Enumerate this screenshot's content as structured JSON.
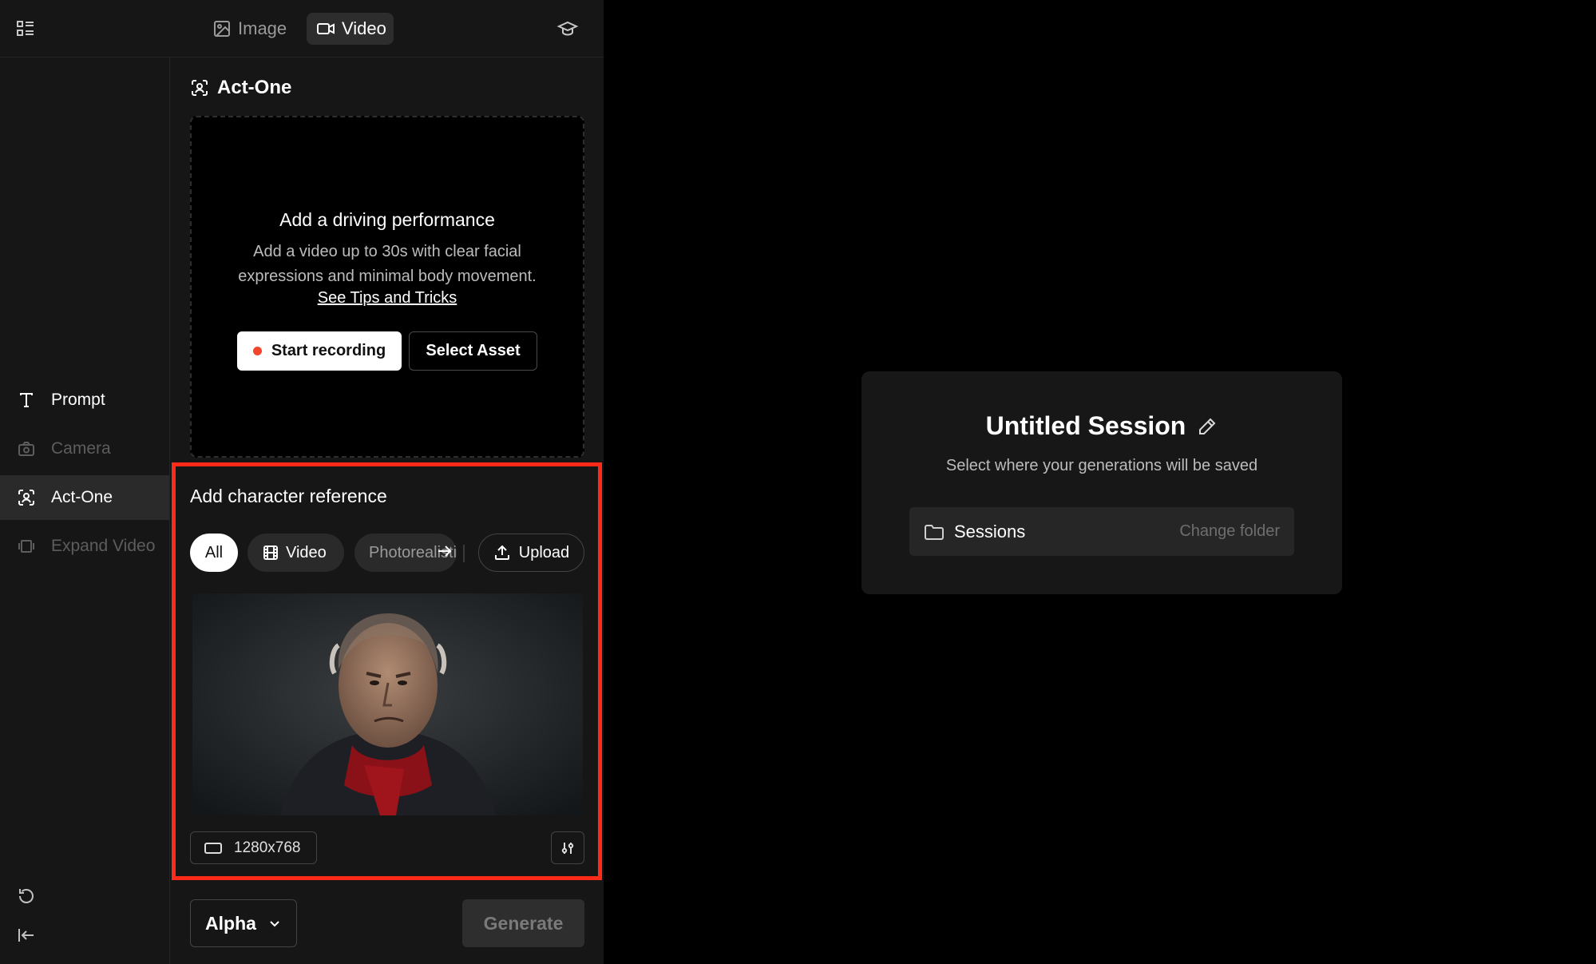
{
  "header": {
    "tabs": [
      {
        "label": "Image",
        "icon": "image-icon"
      },
      {
        "label": "Video",
        "icon": "video-camera-icon",
        "active": true
      }
    ]
  },
  "sidebar": {
    "items": [
      {
        "label": "Prompt",
        "icon": "text-icon",
        "state": "enabled"
      },
      {
        "label": "Camera",
        "icon": "camera-icon",
        "state": "disabled"
      },
      {
        "label": "Act-One",
        "icon": "face-scan-icon",
        "state": "active"
      },
      {
        "label": "Expand Video",
        "icon": "expand-icon",
        "state": "disabled"
      }
    ]
  },
  "panel": {
    "title": "Act-One",
    "dropzone": {
      "title": "Add a driving performance",
      "description": "Add a video up to 30s with clear facial expressions and minimal body movement.",
      "link": "See Tips and Tricks",
      "record_label": "Start recording",
      "asset_label": "Select Asset"
    },
    "character": {
      "title": "Add character reference",
      "filters": {
        "all": "All",
        "video": "Video",
        "photo": "Photorealistic"
      },
      "upload_label": "Upload",
      "resolution": "1280x768"
    },
    "model": "Alpha",
    "generate_label": "Generate"
  },
  "session": {
    "title": "Untitled Session",
    "subtitle": "Select where your generations will be saved",
    "folder": "Sessions",
    "change_label": "Change folder"
  },
  "colors": {
    "highlight": "#ff2a17",
    "record_dot": "#f2452b",
    "panel_bg": "#161616",
    "card_bg": "#171717"
  }
}
